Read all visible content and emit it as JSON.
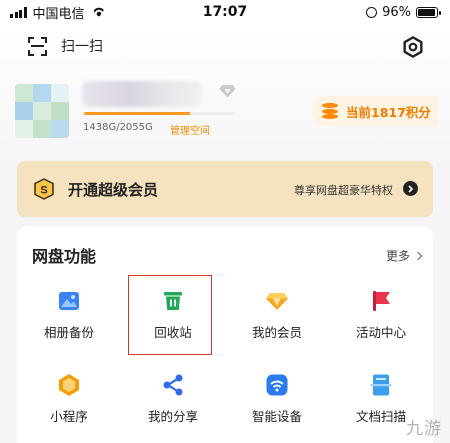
{
  "status_bar": {
    "carrier": "中国电信",
    "time": "17:07",
    "battery": "96%",
    "battery_level": 0.96
  },
  "header": {
    "scan_label": "扫一扫",
    "storage_text": "1438G/2055G",
    "storage_used_fraction": 0.7,
    "manage_link": "管理空间",
    "points_label": "当前1817积分"
  },
  "vip_banner": {
    "badge": "S",
    "title": "开通超级会员",
    "subtitle": "尊享网盘超豪华特权"
  },
  "features": {
    "title": "网盘功能",
    "more_label": "更多",
    "items": [
      {
        "label": "相册备份",
        "icon": "photo-album-icon",
        "color": "#3b82f6"
      },
      {
        "label": "回收站",
        "icon": "trash-icon",
        "color": "#22a85a"
      },
      {
        "label": "我的会员",
        "icon": "diamond-icon",
        "color": "#f5a623"
      },
      {
        "label": "活动中心",
        "icon": "flag-icon",
        "color": "#e8344d"
      },
      {
        "label": "小程序",
        "icon": "mini-program-icon",
        "color": "#f59e0b"
      },
      {
        "label": "我的分享",
        "icon": "share-icon",
        "color": "#2f6bea"
      },
      {
        "label": "智能设备",
        "icon": "smart-device-icon",
        "color": "#2a7bf0"
      },
      {
        "label": "文档扫描",
        "icon": "doc-scan-icon",
        "color": "#3aa0ee"
      }
    ]
  },
  "watermark": "九游"
}
